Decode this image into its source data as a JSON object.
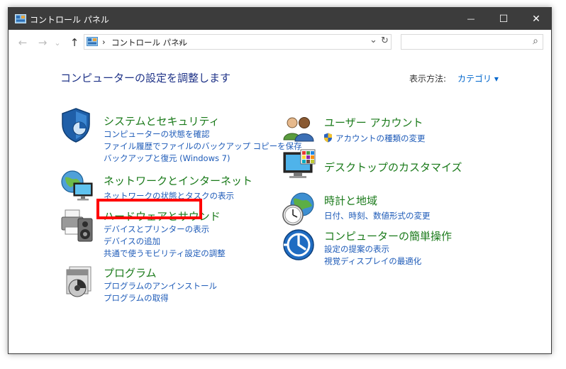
{
  "window": {
    "title": "コントロール パネル",
    "controls": {
      "minimize": "—",
      "maximize": "☐",
      "close": "✕"
    }
  },
  "address": {
    "nav": {
      "back": "←",
      "forward": "→",
      "recent": "⌄",
      "up": "↑"
    },
    "sep1": "›",
    "path": "コントロール パネル",
    "sep2": "›",
    "dropdown": "⌄",
    "refresh": "↻",
    "search_placeholder": "",
    "search_icon": "⌕"
  },
  "main": {
    "heading": "コンピューターの設定を調整します",
    "viewby": {
      "label": "表示方法:",
      "value": "カテゴリ ▾"
    },
    "left": [
      {
        "title": "システムとセキュリティ",
        "icon": "shield-icon",
        "links": [
          "コンピューターの状態を確認",
          "ファイル履歴でファイルのバックアップ コピーを保存",
          "バックアップと復元 (Windows 7)"
        ]
      },
      {
        "title": "ネットワークとインターネット",
        "icon": "network-globe-icon",
        "links": [
          "ネットワークの状態とタスクの表示"
        ]
      },
      {
        "title": "ハードウェアとサウンド",
        "icon": "printer-speaker-icon",
        "links": [
          "デバイスとプリンターの表示",
          "デバイスの追加",
          "共通で使うモビリティ設定の調整"
        ]
      },
      {
        "title": "プログラム",
        "icon": "programs-disc-icon",
        "links": [
          "プログラムのアンインストール",
          "プログラムの取得"
        ]
      }
    ],
    "right": [
      {
        "title": "ユーザー アカウント",
        "icon": "users-icon",
        "links": [
          "アカウントの種類の変更"
        ]
      },
      {
        "title": "デスクトップのカスタマイズ",
        "icon": "monitor-palette-icon",
        "links": []
      },
      {
        "title": "時計と地域",
        "icon": "clock-globe-icon",
        "links": [
          "日付、時刻、数値形式の変更"
        ]
      },
      {
        "title": "コンピューターの簡単操作",
        "icon": "ease-of-access-icon",
        "links": [
          "設定の提案の表示",
          "視覚ディスプレイの最適化"
        ]
      }
    ]
  },
  "colors": {
    "titlebar": "#3c3c3c",
    "heading": "#1e3287",
    "category": "#1a7a1a",
    "link": "#1e5bb8",
    "highlight": "#ff0000"
  }
}
